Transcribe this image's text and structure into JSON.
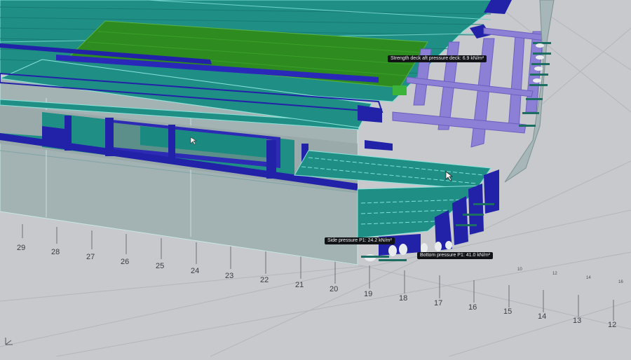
{
  "annotations": {
    "strength_deck": "Strength deck aft pressure deck: 6.9 kN/m²",
    "side_pressure": "Side pressure P1: 24.2 kN/m²",
    "bottom_pressure": "Bottom pressure P1: 41.0 kN/m²"
  },
  "frame_labels": [
    "29",
    "28",
    "27",
    "26",
    "25",
    "24",
    "23",
    "22",
    "21",
    "20",
    "19",
    "18",
    "17",
    "16",
    "15",
    "14",
    "13",
    "12"
  ],
  "small_axis_labels": [
    "10",
    "12",
    "14",
    "16"
  ],
  "colors": {
    "background": "#c7c9cc",
    "plate_teal": "#1f8f86",
    "plate_green": "#2e8b1f",
    "shell_grey": "#9fb3b4",
    "girder_blue": "#2222a8",
    "frame_violet": "#8b7fd6",
    "stiffener": "#1c6e63"
  },
  "icons": {
    "cursor": "mouse-cursor-icon"
  }
}
